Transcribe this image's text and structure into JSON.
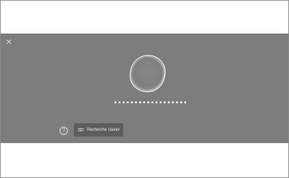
{
  "overlay": {
    "close_icon": "close-icon",
    "orb_icon": "voice-orb-icon",
    "password_dots_count": 18,
    "help_icon": "help-circle-icon",
    "help_glyph": "?",
    "keyboard_button": {
      "icon": "keyboard-icon",
      "label": "Recherche clavier"
    }
  },
  "colors": {
    "page_background": "#ffffff",
    "overlay_background": "#7d7d7d",
    "button_background": "#5d5d5d",
    "text_light": "#f0f0f0"
  }
}
